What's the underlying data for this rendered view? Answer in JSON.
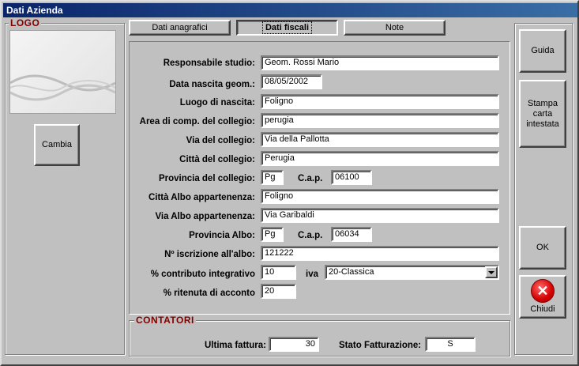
{
  "window": {
    "title": "Dati Azienda"
  },
  "logo_group": {
    "legend": "LOGO",
    "change_label": "Cambia"
  },
  "tabs": [
    {
      "label": "Dati anagrafici",
      "active": false
    },
    {
      "label": "Dati fiscali",
      "active": true
    },
    {
      "label": "Note",
      "active": false
    }
  ],
  "form": {
    "responsabile": {
      "label": "Responsabile studio:",
      "value": "Geom. Rossi Mario"
    },
    "data_nascita": {
      "label": "Data nascita geom.:",
      "value": "08/05/2002"
    },
    "luogo_nascita": {
      "label": "Luogo di nascita:",
      "value": "Foligno"
    },
    "area_collegio": {
      "label": "Area di comp. del collegio:",
      "value": "perugia"
    },
    "via_collegio": {
      "label": "Via del collegio:",
      "value": "Via della Pallotta"
    },
    "citta_collegio": {
      "label": "Città del collegio:",
      "value": "Perugia"
    },
    "provincia_collegio": {
      "label": "Provincia del collegio:",
      "value": "Pg"
    },
    "cap_collegio": {
      "label": "C.a.p.",
      "value": "06100"
    },
    "citta_albo": {
      "label": "Città Albo appartenenza:",
      "value": "Foligno"
    },
    "via_albo": {
      "label": "Via Albo appartenenza:",
      "value": "Via Garibaldi"
    },
    "provincia_albo": {
      "label": "Provincia Albo:",
      "value": "Pg"
    },
    "cap_albo": {
      "label": "C.a.p.",
      "value": "06034"
    },
    "iscrizione_albo": {
      "label": "Nº iscrizione all'albo:",
      "value": "121222"
    },
    "contributo": {
      "label": "% contributo integrativo",
      "value": "10"
    },
    "iva": {
      "label": "iva",
      "value": "20-Classica"
    },
    "ritenuta": {
      "label": "% ritenuta di acconto",
      "value": "20"
    }
  },
  "contatori": {
    "legend": "CONTATORI",
    "ultima_fattura": {
      "label": "Ultima fattura:",
      "value": "30"
    },
    "stato_fatturazione": {
      "label": "Stato Fatturazione:",
      "value": "S"
    }
  },
  "side_buttons": {
    "guida": "Guida",
    "stampa": "Stampa carta intestata",
    "ok": "OK",
    "chiudi": "Chiudi"
  }
}
